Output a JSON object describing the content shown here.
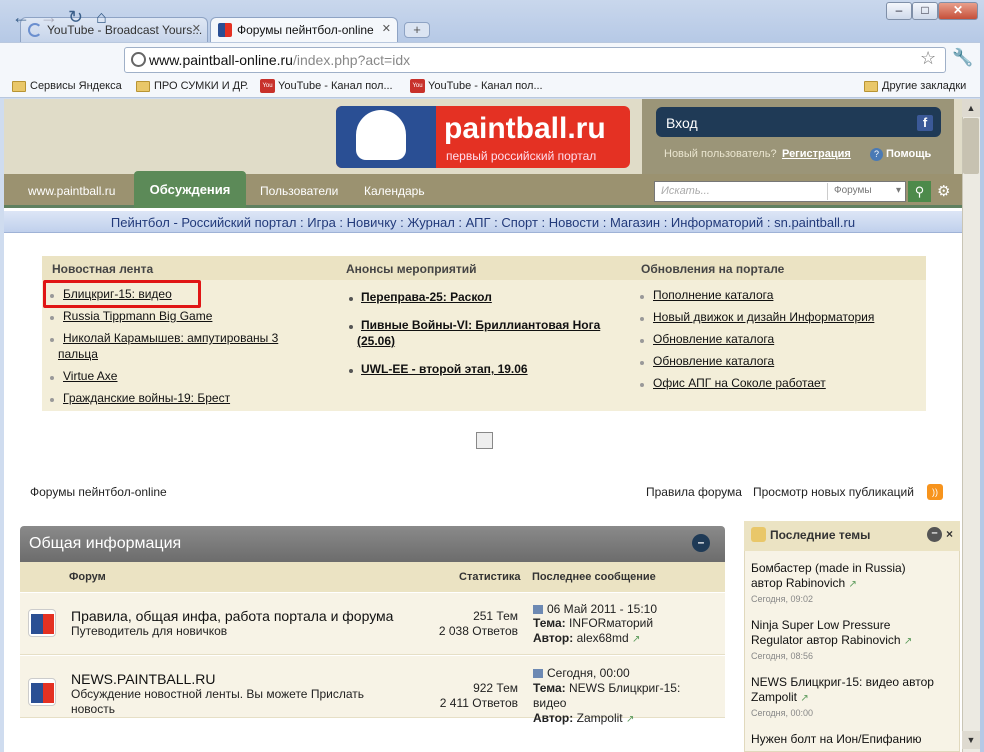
{
  "browser": {
    "tabs": [
      {
        "label": "YouTube - Broadcast Yours..."
      },
      {
        "label": "Форумы пейнтбол-online"
      }
    ],
    "url_domain": "www.paintball-online.ru",
    "url_path": "/index.php?act=idx",
    "bookmarks": [
      {
        "label": "Сервисы Яндекса",
        "icon": "folder-icon"
      },
      {
        "label": "ПРО СУМКИ И ДР.",
        "icon": "folder-icon"
      },
      {
        "label": "YouTube - Канал пол...",
        "icon": "youtube-icon"
      },
      {
        "label": "YouTube - Канал пол...",
        "icon": "youtube-icon"
      },
      {
        "label": "Другие закладки",
        "icon": "folder-icon"
      }
    ]
  },
  "header": {
    "logo_text": "paintball.ru",
    "logo_sub": "первый российский портал",
    "login": "Вход",
    "new_user": "Новый пользователь?",
    "register": "Регистрация",
    "help": "Помощь"
  },
  "nav": {
    "items": [
      "www.paintball.ru",
      "Обсуждения",
      "Пользователи",
      "Календарь"
    ],
    "search_placeholder": "Искать...",
    "search_scope": "Форумы"
  },
  "portal_bar": "Пейнтбол - Российский портал : Игра : Новичку : Журнал : АПГ : Спорт : Новости : Магазин : Информаторий : sn.paintball.ru",
  "news": {
    "feed_title": "Новостная лента",
    "feed": [
      "Блицкриг-15: видео",
      "Russia Tippmann Big Game",
      "Николай Карамышев: ампутированы 3",
      "пальца",
      "Virtue Axe",
      "Гражданские войны-19: Брест"
    ],
    "events_title": "Анонсы мероприятий",
    "events": [
      "Переправа-25: Раскол",
      "Пивные Войны-VI: Бриллиантовая Нога",
      "(25.06)",
      "UWL-EE - второй этап, 19.06"
    ],
    "updates_title": "Обновления на портале",
    "updates": [
      "Пополнение каталога",
      "Новый движок и дизайн Информатория",
      "Обновление каталога",
      "Обновление каталога",
      "Офис АПГ на Соколе работает"
    ]
  },
  "crumbs": {
    "forum_home": "Форумы пейнтбол-online",
    "rules": "Правила форума",
    "new_posts": "Просмотр новых публикаций"
  },
  "forum": {
    "category": "Общая информация",
    "col_forum": "Форум",
    "col_stats": "Статистика",
    "col_last": "Последнее сообщение",
    "rows": [
      {
        "title": "Правила, общая инфа, работа портала и форума",
        "desc1": "Путеводитель для новичков",
        "desc2": "",
        "topics": "251 Тем",
        "replies": "2 038 Ответов",
        "last_date": "06 Май 2011 - 15:10",
        "topic_label": "Тема:",
        "topic1": "INFORматорий",
        "topic2": "",
        "author_label": "Автор:",
        "author": "alex68md"
      },
      {
        "title": "NEWS.PAINTBALL.RU",
        "desc1": "Обсуждение новостной ленты. Вы можете Прислать",
        "desc2": "новость",
        "topics": "922 Тем",
        "replies": "2 411 Ответов",
        "last_date": "Сегодня, 00:00",
        "topic_label": "Тема:",
        "topic1": "NEWS Блицкриг-15:",
        "topic2": "видео",
        "author_label": "Автор:",
        "author": "Zampolit"
      }
    ]
  },
  "sidebar": {
    "title": "Последние темы",
    "close": "×",
    "topics": [
      {
        "line1": "Бомбастер (made in Russia)",
        "line2": "автор Rabinovich",
        "time": "Сегодня, 09:02"
      },
      {
        "line1": "Ninja Super Low Pressure",
        "line2": "Regulator автор Rabinovich",
        "time": "Сегодня, 08:56"
      },
      {
        "line1": "NEWS Блицкриг-15: видео автор",
        "line2": "Zampolit",
        "time": "Сегодня, 00:00"
      },
      {
        "line1": "Нужен болт на Ион/Епифанию",
        "line2": "",
        "time": ""
      }
    ]
  }
}
